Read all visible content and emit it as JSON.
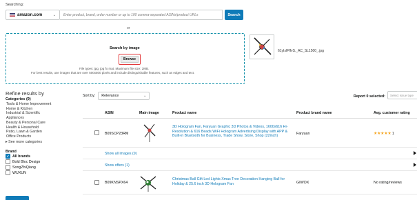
{
  "search": {
    "label": "Searching:",
    "marketplace": "amazon.com",
    "placeholder": "Enter product, brand, order number or up to 100 comma-separated ASINs/product URLs",
    "button": "Search",
    "or": "or"
  },
  "dropzone": {
    "title": "Search by image",
    "browse": "Browse",
    "note1": "File types: jpg, jpg fo mat. Maximum file size: 2MB.",
    "note2": "For best results, use images that are over 500x500 pixels and include distinguishable features, such as edges and text."
  },
  "preview": {
    "filename": "61yIsIFffvS._AC_SL1500_.jpg"
  },
  "refine": {
    "title": "Refine results by",
    "categories_head": "Categories (9)",
    "categories": [
      "Tools & Home Improvement",
      "Home & Kitchen",
      "Industrial & Scientific",
      "Appliances",
      "Beauty & Personal Care",
      "Health & Household",
      "Patio, Lawn & Garden",
      "Office Products"
    ],
    "see_more": "See more categories",
    "brand_head": "Brand",
    "brands": [
      {
        "label": "All brands",
        "checked": true
      },
      {
        "label": "Bold Bloc Design",
        "checked": false
      },
      {
        "label": "SongZhiQiang",
        "checked": false
      },
      {
        "label": "WUXUN",
        "checked": false
      }
    ]
  },
  "toolbar": {
    "sort_label": "Sort by:",
    "sort_value": "Relevance",
    "report_label": "Report 0 selected:",
    "issue_placeholder": "Select issue type"
  },
  "table": {
    "headers": [
      "ASIN",
      "Main image",
      "Product name",
      "Product brand name",
      "Avg. customer rating"
    ],
    "rows": [
      {
        "asin": "B09SCP23RM",
        "name": "3D Hologram Fan, Faryuan Graphic 3D Photos & Videos, 1600x616 Hi-Resolution & 616 Beads WiFi Hologram Advertising Display with APP & Built-in Bluetooth for Business, Trade Show, Store, Shop (22inch)",
        "brand": "Faryuan",
        "rating_stars": "★★★★★",
        "rating_count": "1"
      },
      {
        "asin": "B09KNSPX64",
        "name": "Christmas Ball Gift Led Lights Xmas Tree Decoration Hanging Ball for Holiday & 25.6 inch 3D Hologram Fan",
        "brand": "GIWOX",
        "rating_text": "No rating/reviews"
      }
    ],
    "show_images": "Show all images (9)",
    "show_offers": "Show offers (1)"
  },
  "colors": {
    "accent": "#0f7bb8",
    "stars": "#f5a623",
    "dashed_border": "#0f8fa8",
    "browse_outline": "#e2383a"
  }
}
